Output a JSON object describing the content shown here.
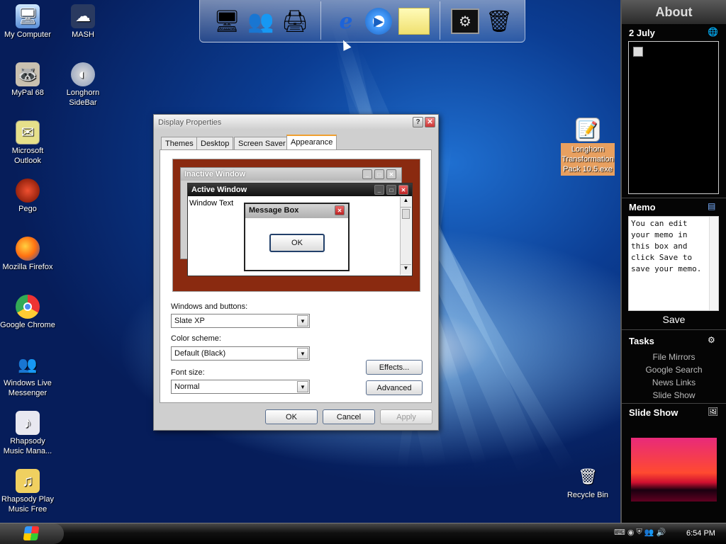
{
  "desktop_icons": [
    {
      "label": "My Computer",
      "icon": "computer-icon"
    },
    {
      "label": "MASH",
      "icon": "mash-icon"
    },
    {
      "label": "MyPal 68",
      "icon": "mypal-icon"
    },
    {
      "label": "Longhorn SideBar",
      "icon": "sidebar-app-icon"
    },
    {
      "label": "Microsoft Outlook",
      "icon": "outlook-icon"
    },
    {
      "label": "Pego",
      "icon": "pego-icon"
    },
    {
      "label": "Mozilla Firefox",
      "icon": "firefox-icon"
    },
    {
      "label": "Google Chrome",
      "icon": "chrome-icon"
    },
    {
      "label": "Windows Live Messenger",
      "icon": "messenger-icon"
    },
    {
      "label": "Rhapsody Music Mana...",
      "icon": "rhapsody-icon"
    },
    {
      "label": "Rhapsody Play Music Free",
      "icon": "rhapsody-play-icon"
    },
    {
      "label": "Longhorn Transformation Pack 10.5.exe",
      "icon": "installer-icon"
    },
    {
      "label": "Recycle Bin",
      "icon": "recycle-bin-icon"
    }
  ],
  "dock": {
    "items": [
      "monitor-icon",
      "users-icon",
      "control-panel-icon",
      "internet-explorer-icon",
      "media-player-icon",
      "notes-icon",
      "settings-window-icon",
      "recycle-bin-icon"
    ]
  },
  "dialog": {
    "title": "Display Properties",
    "help_btn": "?",
    "close_btn": "✕",
    "tabs": [
      "Themes",
      "Desktop",
      "Screen Saver",
      "Appearance"
    ],
    "active_tab": "Appearance",
    "preview": {
      "inactive_title": "Inactive Window",
      "active_title": "Active Window",
      "window_text": "Window Text",
      "msgbox_title": "Message Box",
      "msgbox_ok": "OK"
    },
    "windows_buttons_label": "Windows and buttons:",
    "windows_buttons_value": "Slate XP",
    "color_scheme_label": "Color scheme:",
    "color_scheme_value": "Default (Black)",
    "font_size_label": "Font size:",
    "font_size_value": "Normal",
    "effects_btn": "Effects...",
    "advanced_btn": "Advanced",
    "ok_btn": "OK",
    "cancel_btn": "Cancel",
    "apply_btn": "Apply"
  },
  "sidebar": {
    "header": "About",
    "date": "2 July",
    "memo_title": "Memo",
    "memo_text": "You can edit your memo in this box and click Save to save your memo.",
    "save_btn": "Save",
    "tasks_title": "Tasks",
    "tasks": [
      "File Mirrors",
      "Google Search",
      "News Links",
      "Slide Show"
    ],
    "slideshow_title": "Slide Show"
  },
  "taskbar": {
    "clock": "6:54 PM"
  }
}
